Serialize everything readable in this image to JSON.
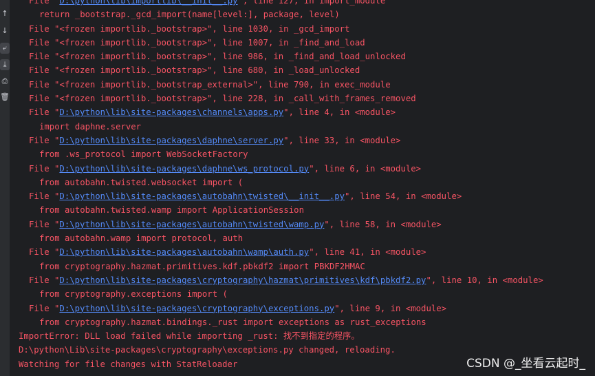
{
  "toolbar": {
    "icons": [
      {
        "name": "scroll-up-icon",
        "glyph": "↑",
        "active": false
      },
      {
        "name": "scroll-down-icon",
        "glyph": "↓",
        "active": false
      },
      {
        "name": "soft-wrap-icon",
        "glyph": "⤶",
        "active": true
      },
      {
        "name": "scroll-to-end-icon",
        "glyph": "⤓",
        "active": true
      },
      {
        "name": "print-icon",
        "glyph": "⎙",
        "active": false
      },
      {
        "name": "trash-icon",
        "glyph": "🗑",
        "active": false
      }
    ]
  },
  "console": {
    "lines": [
      {
        "kind": "file",
        "pre": "File \"",
        "link": "D:\\python\\lib\\importlib\\__init__.py",
        "post": "\", line 127, in import_module"
      },
      {
        "kind": "code",
        "text": "return _bootstrap._gcd_import(name[level:], package, level)"
      },
      {
        "kind": "file",
        "pre": "File \"<frozen importlib._bootstrap>\", line 1030, in _gcd_import",
        "link": "",
        "post": ""
      },
      {
        "kind": "file",
        "pre": "File \"<frozen importlib._bootstrap>\", line 1007, in _find_and_load",
        "link": "",
        "post": ""
      },
      {
        "kind": "file",
        "pre": "File \"<frozen importlib._bootstrap>\", line 986, in _find_and_load_unlocked",
        "link": "",
        "post": ""
      },
      {
        "kind": "file",
        "pre": "File \"<frozen importlib._bootstrap>\", line 680, in _load_unlocked",
        "link": "",
        "post": ""
      },
      {
        "kind": "file",
        "pre": "File \"<frozen importlib._bootstrap_external>\", line 790, in exec_module",
        "link": "",
        "post": ""
      },
      {
        "kind": "file",
        "pre": "File \"<frozen importlib._bootstrap>\", line 228, in _call_with_frames_removed",
        "link": "",
        "post": ""
      },
      {
        "kind": "file",
        "pre": "File \"",
        "link": "D:\\python\\lib\\site-packages\\channels\\apps.py",
        "post": "\", line 4, in <module>"
      },
      {
        "kind": "code",
        "text": "import daphne.server"
      },
      {
        "kind": "file",
        "pre": "File \"",
        "link": "D:\\python\\lib\\site-packages\\daphne\\server.py",
        "post": "\", line 33, in <module>"
      },
      {
        "kind": "code",
        "text": "from .ws_protocol import WebSocketFactory"
      },
      {
        "kind": "file",
        "pre": "File \"",
        "link": "D:\\python\\lib\\site-packages\\daphne\\ws_protocol.py",
        "post": "\", line 6, in <module>"
      },
      {
        "kind": "code",
        "text": "from autobahn.twisted.websocket import ("
      },
      {
        "kind": "file",
        "pre": "File \"",
        "link": "D:\\python\\lib\\site-packages\\autobahn\\twisted\\__init__.py",
        "post": "\", line 54, in <module>"
      },
      {
        "kind": "code",
        "text": "from autobahn.twisted.wamp import ApplicationSession"
      },
      {
        "kind": "file",
        "pre": "File \"",
        "link": "D:\\python\\lib\\site-packages\\autobahn\\twisted\\wamp.py",
        "post": "\", line 58, in <module>"
      },
      {
        "kind": "code",
        "text": "from autobahn.wamp import protocol, auth"
      },
      {
        "kind": "file",
        "pre": "File \"",
        "link": "D:\\python\\lib\\site-packages\\autobahn\\wamp\\auth.py",
        "post": "\", line 41, in <module>"
      },
      {
        "kind": "code",
        "text": "from cryptography.hazmat.primitives.kdf.pbkdf2 import PBKDF2HMAC"
      },
      {
        "kind": "file",
        "pre": "File \"",
        "link": "D:\\python\\lib\\site-packages\\cryptography\\hazmat\\primitives\\kdf\\pbkdf2.py",
        "post": "\", line 10, in <module>"
      },
      {
        "kind": "code",
        "text": "from cryptography.exceptions import ("
      },
      {
        "kind": "file",
        "pre": "File \"",
        "link": "D:\\python\\lib\\site-packages\\cryptography\\exceptions.py",
        "post": "\", line 9, in <module>"
      },
      {
        "kind": "code",
        "text": "from cryptography.hazmat.bindings._rust import exceptions as rust_exceptions"
      },
      {
        "kind": "plain",
        "text": "ImportError: DLL load failed while importing _rust: 找不到指定的程序。"
      },
      {
        "kind": "plain",
        "text": "D:\\python\\Lib\\site-packages\\cryptography\\exceptions.py changed, reloading."
      },
      {
        "kind": "plain",
        "text": "Watching for file changes with StatReloader"
      }
    ]
  },
  "watermark": "CSDN @_坐看云起时_",
  "colors": {
    "error_text": "#f75464",
    "link": "#548af7",
    "background": "#1e1f22"
  }
}
